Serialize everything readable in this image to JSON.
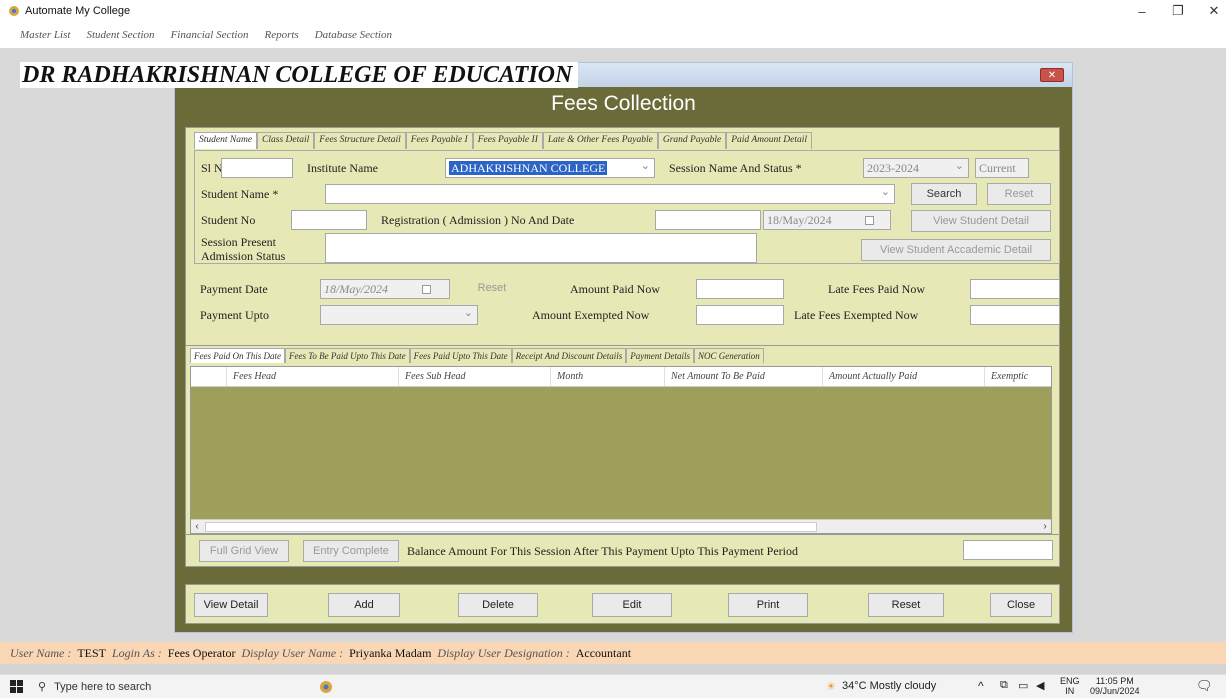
{
  "app": {
    "title": "Automate My College"
  },
  "menu": [
    "Master List",
    "Student Section",
    "Financial Section",
    "Reports",
    "Database Section"
  ],
  "college_name": "DR RADHAKRISHNAN COLLEGE OF EDUCATION",
  "form_title": "Fees Collection",
  "tabs": [
    "Student Name",
    "Class Detail",
    "Fees Structure Detail",
    "Fees Payable I",
    "Fees Payable II",
    "Late & Other Fees Payable",
    "Grand Payable",
    "Paid Amount Detail"
  ],
  "student": {
    "sl_no_label": "Sl No",
    "sl_no_value": "",
    "institute_label": "Institute Name",
    "institute_value": "ADHAKRISHNAN COLLEGE",
    "session_label": "Session Name And Status *",
    "session_value": "2023-2024",
    "session_status": "Current",
    "student_name_label": "Student Name *",
    "student_name_value": "",
    "search_button": "Search",
    "reset_button": "Reset",
    "student_no_label": "Student No",
    "student_no_value": "",
    "registration_label": "Registration ( Admission ) No And Date",
    "registration_no": "",
    "registration_date": "18/May/2024",
    "view_student_detail": "View Student Detail",
    "session_present_label_1": "Session Present",
    "session_present_label_2": "Admission Status",
    "session_present_value": "",
    "view_academic_detail": "View Student Accademic Detail"
  },
  "payment": {
    "payment_date_label": "Payment Date",
    "payment_date_value": "18/May/2024",
    "reset_button": "Reset",
    "amount_paid_label": "Amount Paid Now",
    "amount_paid_value": "",
    "late_fees_paid_label": "Late Fees Paid Now",
    "late_fees_paid_value": "",
    "payment_upto_label": "Payment Upto",
    "payment_upto_value": "",
    "amount_exempted_label": "Amount Exempted Now",
    "amount_exempted_value": "",
    "late_fees_exempted_label": "Late Fees Exempted Now",
    "late_fees_exempted_value": ""
  },
  "grid_tabs": [
    "Fees Paid On This Date",
    "Fees To Be Paid Upto This Date",
    "Fees Paid Upto This Date",
    "Receipt And Discount Details",
    "Payment Details",
    "NOC Generation"
  ],
  "grid_columns": [
    "Fees Head",
    "Fees Sub Head",
    "Month",
    "Net Amount To Be Paid",
    "Amount Actually Paid",
    "Exemptic"
  ],
  "bottom": {
    "full_grid_view": "Full Grid View",
    "entry_complete": "Entry Complete",
    "balance_label": "Balance Amount For This Session After This Payment Upto This Payment Period",
    "balance_value": ""
  },
  "actions": [
    "View Detail",
    "Add",
    "Delete",
    "Edit",
    "Print",
    "Reset",
    "Close"
  ],
  "status": {
    "user_name_key": "User Name :",
    "user_name": "TEST",
    "login_as_key": "Login As :",
    "login_as": "Fees Operator",
    "display_user_name_key": "Display User Name :",
    "display_user_name": "Priyanka Madam",
    "designation_key": "Display User Designation :",
    "designation": "Accountant"
  },
  "taskbar": {
    "search_placeholder": "Type here to search",
    "weather": "34°C  Mostly cloudy",
    "lang_1": "ENG",
    "lang_2": "IN",
    "time": "11:05 PM",
    "date": "09/Jun/2024"
  },
  "colors": {
    "olive_frame": "#6b6b3a",
    "panel_bg": "#e6e8b5",
    "grid_bg": "#9f9f5c",
    "status_bg": "#f9d6b4",
    "selection": "#2b64c5"
  }
}
